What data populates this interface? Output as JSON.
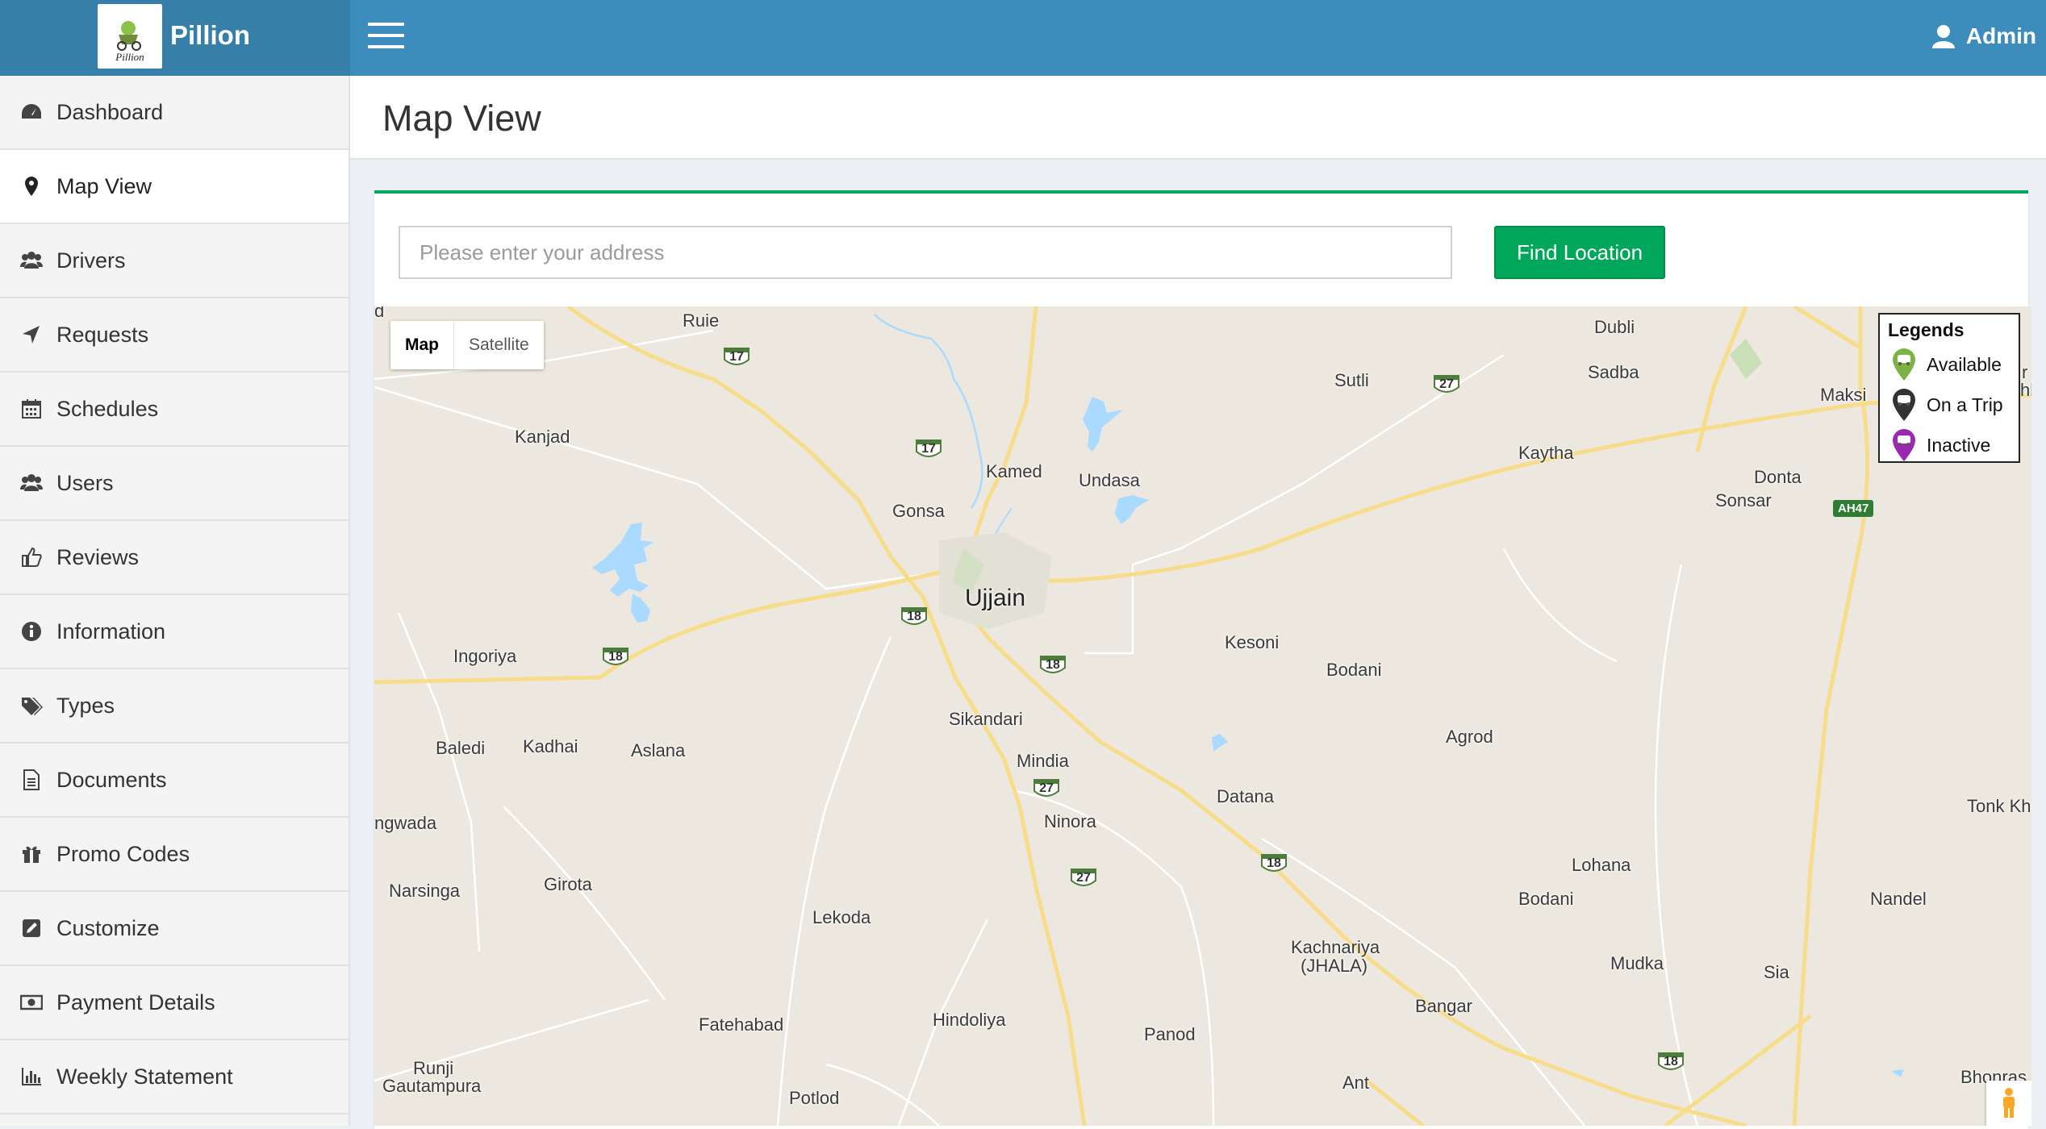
{
  "app": {
    "name": "Pillion",
    "logo_text": "Pillion"
  },
  "header": {
    "user_label": "Admin"
  },
  "sidebar": {
    "items": [
      {
        "label": "Dashboard",
        "icon": "dashboard-icon"
      },
      {
        "label": "Map View",
        "icon": "map-marker-icon",
        "active": true
      },
      {
        "label": "Drivers",
        "icon": "users-icon"
      },
      {
        "label": "Requests",
        "icon": "location-arrow-icon"
      },
      {
        "label": "Schedules",
        "icon": "calendar-icon"
      },
      {
        "label": "Users",
        "icon": "users-icon"
      },
      {
        "label": "Reviews",
        "icon": "thumbs-up-icon"
      },
      {
        "label": "Information",
        "icon": "info-circle-icon"
      },
      {
        "label": "Types",
        "icon": "tags-icon"
      },
      {
        "label": "Documents",
        "icon": "file-text-icon"
      },
      {
        "label": "Promo Codes",
        "icon": "gift-icon"
      },
      {
        "label": "Customize",
        "icon": "edit-icon"
      },
      {
        "label": "Payment Details",
        "icon": "money-icon"
      },
      {
        "label": "Weekly Statement",
        "icon": "bar-chart-icon"
      }
    ]
  },
  "page": {
    "title": "Map View"
  },
  "search": {
    "placeholder": "Please enter your address",
    "value": "",
    "button_label": "Find Location"
  },
  "map": {
    "type_controls": {
      "map": "Map",
      "satellite": "Satellite",
      "selected": "Map"
    },
    "legend": {
      "title": "Legends",
      "items": [
        {
          "label": "Available",
          "color": "#7cb342"
        },
        {
          "label": "On a Trip",
          "color": "#333333"
        },
        {
          "label": "Inactive",
          "color": "#9c27b0"
        }
      ]
    },
    "places": {
      "ujjain": "Ujjain",
      "ruie": "Ruie",
      "kanjad": "Kanjad",
      "kamed": "Kamed",
      "undasa": "Undasa",
      "gonsa": "Gonsa",
      "sutli": "Sutli",
      "dubli": "Dubli",
      "sadba": "Sadba",
      "maksi": "Maksi",
      "kaytha": "Kaytha",
      "donta": "Donta",
      "sonsar": "Sonsar",
      "ingoriya": "Ingoriya",
      "kesoni": "Kesoni",
      "bodani1": "Bodani",
      "sikandari": "Sikandari",
      "baledi": "Baledi",
      "kadhai": "Kadhai",
      "aslana": "Aslana",
      "agrod": "Agrod",
      "mindia": "Mindia",
      "datana": "Datana",
      "ninora": "Ninora",
      "angwada": "ngwada",
      "tonk": "Tonk Kh",
      "narsinga": "Narsinga",
      "girota": "Girota",
      "lohana": "Lohana",
      "nandel": "Nandel",
      "bodani2": "Bodani",
      "lekoda": "Lekoda",
      "kachnariya": "Kachnariya",
      "jhala": "(JHALA)",
      "mudka": "Mudka",
      "sia": "Sia",
      "bangar": "Bangar",
      "fatehabad": "Fatehabad",
      "hindoliya": "Hindoliya",
      "panod": "Panod",
      "runji": "Runji",
      "gautampura": "Gautampura",
      "potlod": "Potlod",
      "ant": "Ant",
      "bhonras": "Bhonras",
      "edge_d": "d",
      "edge_r": "r",
      "edge_hl": "hl"
    },
    "highway_numbers": {
      "h17a": "17",
      "h17b": "17",
      "h27a": "27",
      "h27b": "27",
      "h27c": "27",
      "h18a": "18",
      "h18b": "18",
      "h18c": "18",
      "h18d": "18",
      "h18e": "18",
      "ah47": "AH47"
    }
  }
}
